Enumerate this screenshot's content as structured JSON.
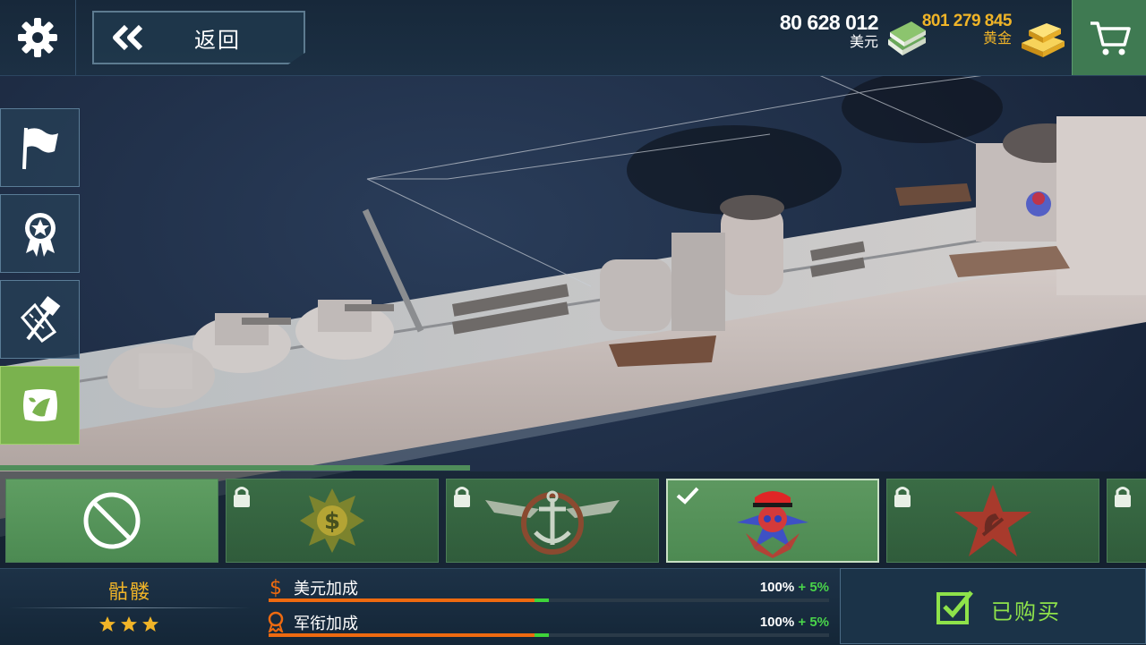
{
  "header": {
    "back_label": "返回",
    "usd_amount": "80 628 012",
    "usd_unit": "美元",
    "gold_amount": "801 279 845",
    "gold_unit": "黄金"
  },
  "icons": {
    "settings": "gear-icon",
    "back": "double-chevron-left-icon",
    "usd": "cash-stack-icon",
    "gold": "gold-bars-icon",
    "cart": "shopping-cart-icon",
    "side_menu": [
      "flag-icon",
      "medal-icon",
      "hammer-ruler-icon",
      "camouflage-icon"
    ]
  },
  "skins": {
    "tiles": [
      {
        "id": "none",
        "locked": false,
        "selected": false,
        "emblem": "no-skin-icon"
      },
      {
        "id": "dollar",
        "locked": true,
        "selected": false,
        "emblem": "dollar-emblem-icon"
      },
      {
        "id": "navy",
        "locked": true,
        "selected": false,
        "emblem": "anchor-wings-emblem-icon"
      },
      {
        "id": "skull",
        "locked": false,
        "selected": true,
        "emblem": "skull-emblem-icon"
      },
      {
        "id": "star",
        "locked": true,
        "selected": false,
        "emblem": "red-star-emblem-icon"
      },
      {
        "id": "more",
        "locked": true,
        "selected": false,
        "emblem": ""
      }
    ]
  },
  "selected_skin": {
    "name": "骷髅",
    "stars": 3,
    "bonuses": [
      {
        "icon": "dollar-icon",
        "label": "美元加成",
        "value": "100%",
        "extra": "+ 5%",
        "base_fraction": 0.95,
        "extra_fraction": 0.05
      },
      {
        "icon": "rank-medal-icon",
        "label": "军衔加成",
        "value": "100%",
        "extra": "+ 5%",
        "base_fraction": 0.95,
        "extra_fraction": 0.05
      }
    ],
    "status_label": "已购买"
  },
  "colors": {
    "accent_green": "#7ab24e",
    "gold": "#f0b428",
    "bar_orange": "#ee6a10",
    "bar_green": "#3ed43a"
  }
}
